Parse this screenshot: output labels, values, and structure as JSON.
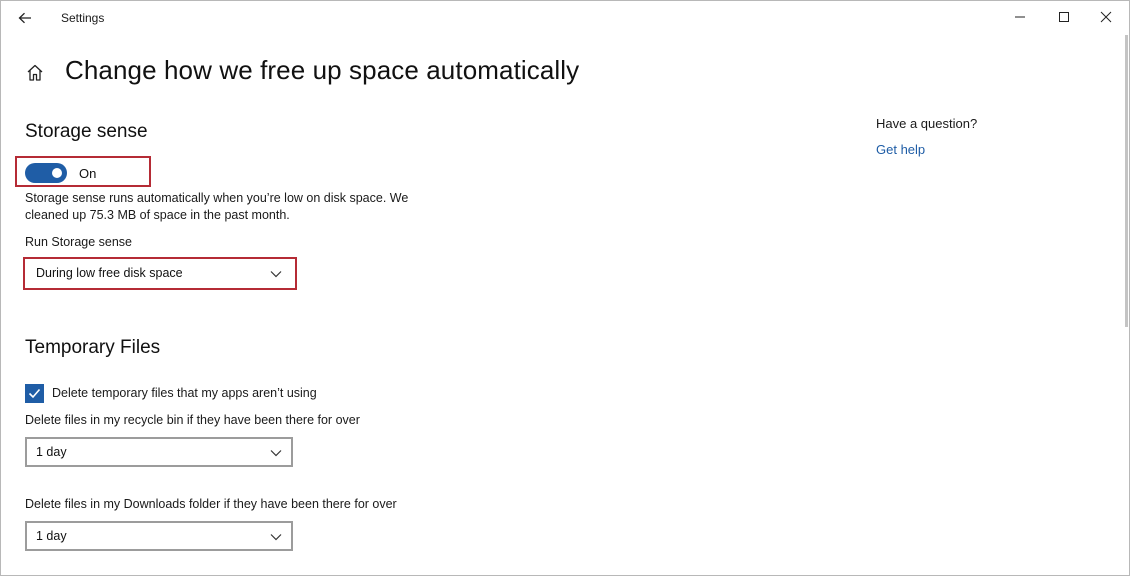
{
  "titlebar": {
    "title": "Settings",
    "back_icon": "back-arrow-icon",
    "controls": [
      "minimize-icon",
      "maximize-icon",
      "close-icon"
    ]
  },
  "header": {
    "home_icon": "home-icon",
    "title": "Change how we free up space automatically"
  },
  "storage_sense": {
    "heading": "Storage sense",
    "toggle_state": "On",
    "description_line1": "Storage sense runs automatically when you’re low on disk space. We",
    "description_line2": "cleaned up 75.3 MB of space in the past month.",
    "run_label": "Run Storage sense",
    "run_value": "During low free disk space"
  },
  "temporary_files": {
    "heading": "Temporary Files",
    "delete_temp_label": "Delete temporary files that my apps aren’t using",
    "delete_temp_checked": true,
    "recycle_label": "Delete files in my recycle bin if they have been there for over",
    "recycle_value": "1 day",
    "downloads_label": "Delete files in my Downloads folder if they have been there for over",
    "downloads_value": "1 day"
  },
  "side": {
    "question": "Have a question?",
    "help_link": "Get help"
  },
  "colors": {
    "accent": "#1f5da6",
    "highlight": "#b52b35"
  }
}
